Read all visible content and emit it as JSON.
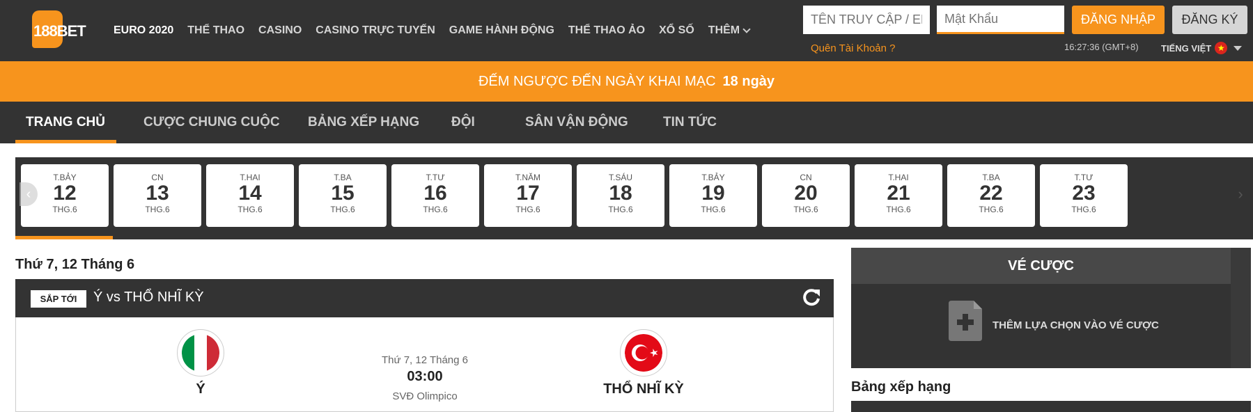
{
  "brand": {
    "logo_text": "188BET",
    "accent_color": "#f7941d",
    "dark_color": "#333333"
  },
  "nav": {
    "items": [
      {
        "label": "EURO 2020",
        "active": true
      },
      {
        "label": "THỂ THAO"
      },
      {
        "label": "CASINO"
      },
      {
        "label": "CASINO TRỰC TUYẾN"
      },
      {
        "label": "GAME HÀNH ĐỘNG"
      },
      {
        "label": "THỂ THAO ẢO"
      },
      {
        "label": "XỔ SỐ"
      },
      {
        "label": "THÊM"
      }
    ]
  },
  "login": {
    "username_placeholder": "TÊN TRUY CẬP / EMAIL",
    "password_placeholder": "Mật Khẩu",
    "login_label": "ĐĂNG NHẬP",
    "register_label": "ĐĂNG KÝ",
    "forgot_label": "Quên Tài Khoản ?"
  },
  "clock": "16:27:36 (GMT+8)",
  "language": {
    "label": "TIẾNG VIỆT",
    "flag_icon": "vietnam-flag-icon"
  },
  "countdown": {
    "text": "ĐẾM NGƯỢC ĐẾN NGÀY KHAI MẠC",
    "days": "18 ngày"
  },
  "subnav": {
    "items": [
      {
        "label": "TRANG CHỦ",
        "active": true
      },
      {
        "label": "CƯỢC CHUNG CUỘC"
      },
      {
        "label": "BẢNG XẾP HẠNG"
      },
      {
        "label": "ĐỘI"
      },
      {
        "label": "SÂN VẬN ĐỘNG"
      },
      {
        "label": "TIN TỨC"
      }
    ]
  },
  "dates": [
    {
      "dow": "T.BẢY",
      "day": "12",
      "month": "THG.6",
      "selected": true
    },
    {
      "dow": "CN",
      "day": "13",
      "month": "THG.6"
    },
    {
      "dow": "T.HAI",
      "day": "14",
      "month": "THG.6"
    },
    {
      "dow": "T.BA",
      "day": "15",
      "month": "THG.6"
    },
    {
      "dow": "T.TƯ",
      "day": "16",
      "month": "THG.6"
    },
    {
      "dow": "T.NĂM",
      "day": "17",
      "month": "THG.6"
    },
    {
      "dow": "T.SÁU",
      "day": "18",
      "month": "THG.6"
    },
    {
      "dow": "T.BẢY",
      "day": "19",
      "month": "THG.6"
    },
    {
      "dow": "CN",
      "day": "20",
      "month": "THG.6"
    },
    {
      "dow": "T.HAI",
      "day": "21",
      "month": "THG.6"
    },
    {
      "dow": "T.BA",
      "day": "22",
      "month": "THG.6"
    },
    {
      "dow": "T.TƯ",
      "day": "23",
      "month": "THG.6"
    }
  ],
  "date_heading": "Thứ 7, 12 Tháng 6",
  "match": {
    "status": "SẮP TỚI",
    "title": "Ý vs THỔ NHĨ KỲ",
    "home": {
      "name": "Ý",
      "flag_icon": "italy-flag-icon"
    },
    "away": {
      "name": "THỔ NHĨ KỲ",
      "flag_icon": "turkey-flag-icon"
    },
    "date": "Thứ 7, 12 Tháng 6",
    "time": "03:00",
    "venue": "SVĐ Olimpico"
  },
  "betslip": {
    "title": "VÉ CƯỢC",
    "add_label": "THÊM LỰA CHỌN VÀO VÉ CƯỢC"
  },
  "standings": {
    "title": "Bảng xếp hạng"
  }
}
